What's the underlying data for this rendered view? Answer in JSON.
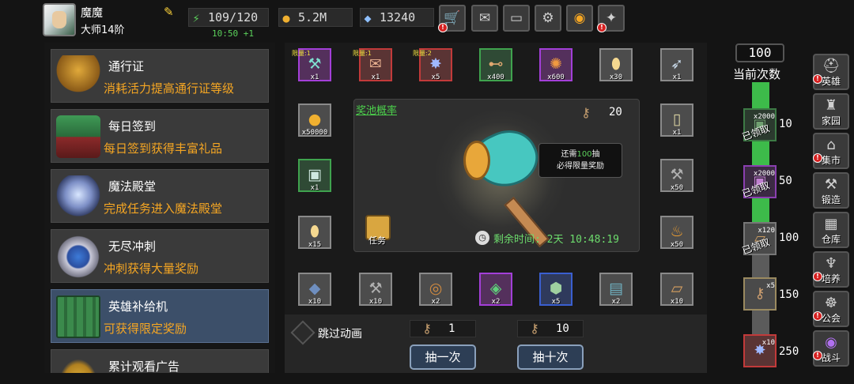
{
  "player": {
    "name": "魔魔",
    "rank": "大师14阶"
  },
  "resources": {
    "energy": "109/120",
    "energy_timer": "10:50 +1",
    "gold": "5.2M",
    "gems": "13240"
  },
  "top_buttons": [
    "shop-cart-icon",
    "mail-icon",
    "gamepad-icon",
    "settings-gear-icon",
    "color-wheel-icon",
    "fireworks-icon"
  ],
  "menu": [
    {
      "title": "通行证",
      "desc": "消耗活力提高通行证等级",
      "icon": "golden-chalice-icon"
    },
    {
      "title": "每日签到",
      "desc": "每日签到获得丰富礼品",
      "icon": "gift-books-icon"
    },
    {
      "title": "魔法殿堂",
      "desc": "完成任务进入魔法殿堂",
      "icon": "crystal-crown-icon"
    },
    {
      "title": "无尽冲刺",
      "desc": "冲刺获得大量奖励",
      "icon": "winged-shield-icon"
    },
    {
      "title": "英雄补给机",
      "desc": "可获得限定奖励",
      "icon": "supply-machine-icon",
      "active": true
    },
    {
      "title": "累计观看广告",
      "desc": "",
      "icon": "gold-coins-icon"
    }
  ],
  "rewards": {
    "top_row": [
      {
        "qty": "x1",
        "limit": "限量:1",
        "rarity": "purple",
        "icon": "crystal-staff-icon"
      },
      {
        "qty": "x1",
        "limit": "限量:1",
        "rarity": "red",
        "icon": "fish-scroll-icon"
      },
      {
        "qty": "x5",
        "limit": "限量:2",
        "rarity": "red",
        "icon": "blue-star-icon"
      },
      {
        "qty": "x400",
        "limit": "",
        "rarity": "green",
        "icon": "bone-icon"
      },
      {
        "qty": "x600",
        "limit": "",
        "rarity": "purple",
        "icon": "fire-scroll-icon"
      },
      {
        "qty": "x30",
        "limit": "",
        "rarity": "gray",
        "icon": "egg-icon"
      },
      {
        "qty": "x1",
        "limit": "",
        "rarity": "gray",
        "icon": "feather-icon"
      }
    ],
    "left_col": [
      {
        "qty": "x50000",
        "rarity": "gray",
        "icon": "gold-coin-icon"
      },
      {
        "qty": "x1",
        "rarity": "green",
        "icon": "chest-icon"
      },
      {
        "qty": "x15",
        "rarity": "gray",
        "icon": "egg-icon"
      }
    ],
    "right_col": [
      {
        "qty": "x1",
        "rarity": "gray",
        "icon": "mirror-icon"
      },
      {
        "qty": "x50",
        "rarity": "gray",
        "icon": "mace-icon"
      },
      {
        "qty": "x50",
        "rarity": "gray",
        "icon": "flame-icon"
      }
    ],
    "bottom_row": [
      {
        "qty": "x10",
        "rarity": "gray",
        "icon": "ore-icon"
      },
      {
        "qty": "x10",
        "rarity": "gray",
        "icon": "mace-icon"
      },
      {
        "qty": "x2",
        "rarity": "gray",
        "icon": "bronze-coin-icon"
      },
      {
        "qty": "x2",
        "rarity": "purple",
        "icon": "green-gem-icon"
      },
      {
        "qty": "x5",
        "rarity": "blue",
        "icon": "rune-stone-icon"
      },
      {
        "qty": "x2",
        "rarity": "gray",
        "icon": "blue-book-icon"
      },
      {
        "qty": "x10",
        "rarity": "gray",
        "icon": "scroll-icon"
      }
    ]
  },
  "pool": {
    "link": "奖池概率",
    "key_count": "20",
    "tip_prefix": "还需",
    "tip_number": "100",
    "tip_suffix": "抽",
    "tip_line2": "必得限量奖励",
    "task_label": "任务",
    "timer_label": "剩余时间:",
    "timer_value": "2天 10:48:19"
  },
  "draw": {
    "skip_label": "跳过动画",
    "single_cost": "1",
    "ten_cost": "10",
    "single_label": "抽一次",
    "ten_label": "抽十次"
  },
  "milestones": {
    "current": "100",
    "current_label": "当前次数",
    "progress": 0.58,
    "items": [
      {
        "count": "10",
        "qty": "x2000",
        "claimed": "已领取",
        "icon": "dark-green-box-icon"
      },
      {
        "count": "50",
        "qty": "x2000",
        "claimed": "已领取",
        "icon": "purple-box-icon"
      },
      {
        "count": "100",
        "qty": "x120",
        "claimed": "已领取",
        "icon": "brown-scroll-icon"
      },
      {
        "count": "150",
        "qty": "x5",
        "claimed": "",
        "icon": "bronze-key-icon"
      },
      {
        "count": "250",
        "qty": "x10",
        "claimed": "",
        "icon": "blue-star-icon"
      }
    ]
  },
  "nav": [
    {
      "label": "英雄",
      "icon": "helmet-icon",
      "alert": true
    },
    {
      "label": "家园",
      "icon": "castle-icon",
      "alert": false
    },
    {
      "label": "集市",
      "icon": "market-icon",
      "alert": true
    },
    {
      "label": "锻造",
      "icon": "anvil-icon",
      "alert": false
    },
    {
      "label": "仓库",
      "icon": "warehouse-icon",
      "alert": false
    },
    {
      "label": "培养",
      "icon": "goblet-icon",
      "alert": true
    },
    {
      "label": "公会",
      "icon": "guild-icon",
      "alert": true
    },
    {
      "label": "战斗",
      "icon": "portal-icon",
      "alert": true
    }
  ],
  "colors": {
    "accent_green": "#4cd14c",
    "desc_orange": "#f5a623",
    "active_menu": "#3c4f69",
    "alert_red": "#d62020"
  }
}
